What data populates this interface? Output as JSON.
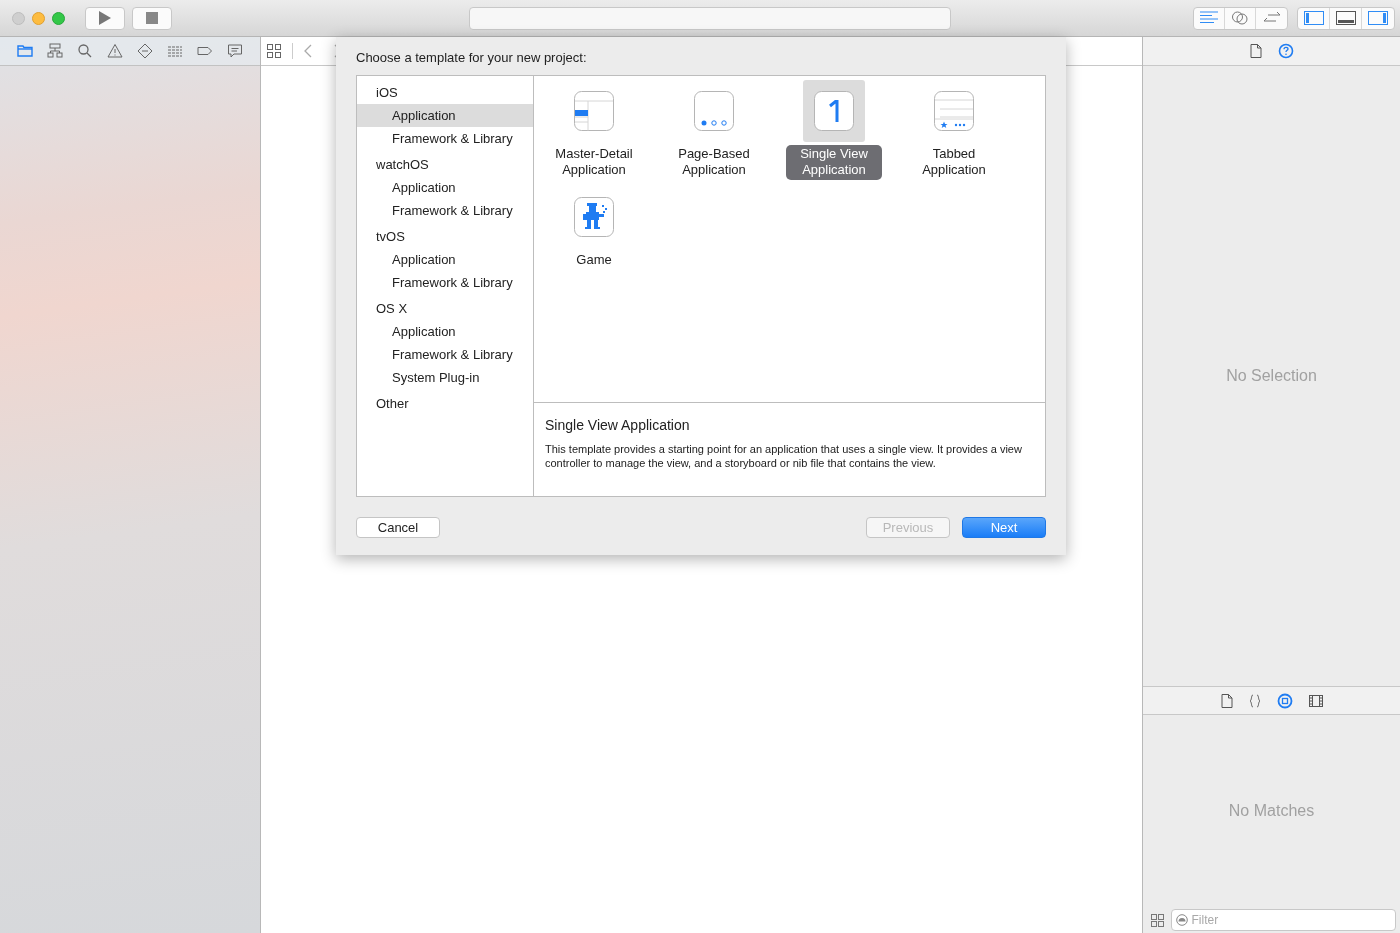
{
  "toolbar": {
    "editor_modes": [
      {
        "selected": true
      },
      {
        "selected": false
      },
      {
        "selected": false
      }
    ],
    "panels": [
      {
        "shown": true
      },
      {
        "shown": false
      },
      {
        "shown": true
      }
    ]
  },
  "navigator_tabs": [
    {
      "selected": true
    },
    {
      "selected": false
    },
    {
      "selected": false
    },
    {
      "selected": false
    },
    {
      "selected": false
    },
    {
      "selected": false
    },
    {
      "selected": false
    },
    {
      "selected": false
    }
  ],
  "dialog": {
    "title": "Choose a template for your new project:",
    "platforms": [
      {
        "label": "iOS",
        "selected": false,
        "children": [
          {
            "label": "Application",
            "selected": true
          },
          {
            "label": "Framework & Library",
            "selected": false
          }
        ]
      },
      {
        "label": "watchOS",
        "selected": false,
        "children": [
          {
            "label": "Application",
            "selected": false
          },
          {
            "label": "Framework & Library",
            "selected": false
          }
        ]
      },
      {
        "label": "tvOS",
        "selected": false,
        "children": [
          {
            "label": "Application",
            "selected": false
          },
          {
            "label": "Framework & Library",
            "selected": false
          }
        ]
      },
      {
        "label": "OS X",
        "selected": false,
        "children": [
          {
            "label": "Application",
            "selected": false
          },
          {
            "label": "Framework & Library",
            "selected": false
          },
          {
            "label": "System Plug-in",
            "selected": false
          }
        ]
      },
      {
        "label": "Other",
        "selected": false
      }
    ],
    "templates": [
      {
        "label": "Master-Detail Application",
        "selected": false
      },
      {
        "label": "Page-Based Application",
        "selected": false
      },
      {
        "label": "Single View Application",
        "selected": true
      },
      {
        "label": "Tabbed Application",
        "selected": false
      },
      {
        "label": "Game",
        "selected": false
      }
    ],
    "description": {
      "title": "Single View Application",
      "text": "This template provides a starting point for an application that uses a single view. It provides a view controller to manage the view, and a storyboard or nib file that contains the view."
    },
    "buttons": [
      {
        "label": "Cancel",
        "kind": "plain",
        "disabled": false
      },
      {
        "label": "Previous",
        "kind": "plain",
        "disabled": true
      },
      {
        "label": "Next",
        "kind": "default",
        "disabled": false
      }
    ]
  },
  "inspector": {
    "tabs": [
      {
        "selected": false
      },
      {
        "selected": true
      }
    ],
    "empty_text": "No Selection"
  },
  "library": {
    "tabs": [
      {
        "selected": false
      },
      {
        "selected": false
      },
      {
        "selected": true
      },
      {
        "selected": false
      }
    ],
    "empty_text": "No Matches",
    "filter": {
      "placeholder": "Filter"
    }
  }
}
